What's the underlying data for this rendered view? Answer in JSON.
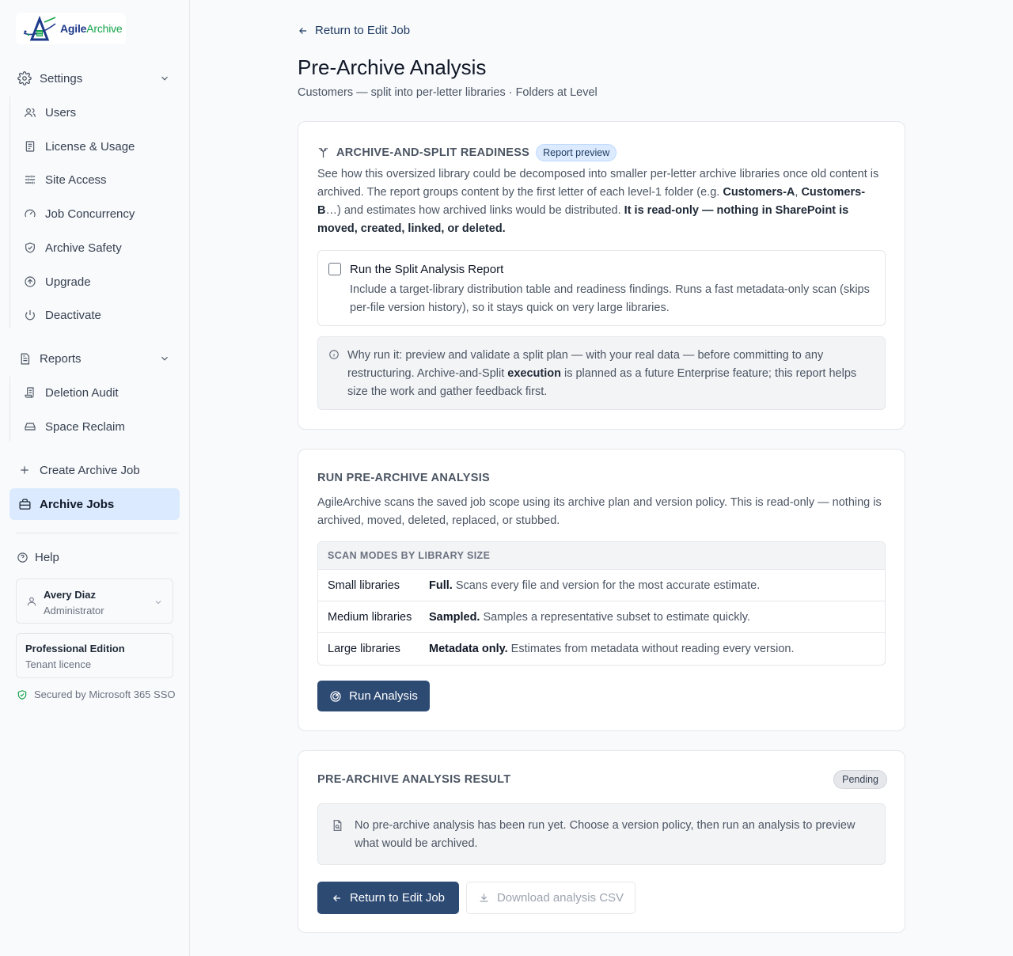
{
  "brand": {
    "logo_part1": "Agile",
    "logo_part2": "Archive"
  },
  "sidebar": {
    "settings": {
      "label": "Settings",
      "items": [
        {
          "label": "Users",
          "icon": "users-icon"
        },
        {
          "label": "License & Usage",
          "icon": "document-icon"
        },
        {
          "label": "Site Access",
          "icon": "sliders-icon"
        },
        {
          "label": "Job Concurrency",
          "icon": "gauge-icon"
        },
        {
          "label": "Archive Safety",
          "icon": "shield-check-icon"
        },
        {
          "label": "Upgrade",
          "icon": "upgrade-circle-icon"
        },
        {
          "label": "Deactivate",
          "icon": "power-icon"
        }
      ]
    },
    "reports": {
      "label": "Reports",
      "items": [
        {
          "label": "Deletion Audit",
          "icon": "scroll-icon"
        },
        {
          "label": "Space Reclaim",
          "icon": "hard-drive-icon"
        }
      ]
    },
    "create_job": "Create Archive Job",
    "archive_jobs": "Archive Jobs",
    "help": "Help",
    "user": {
      "name": "Avery Diaz",
      "role": "Administrator"
    },
    "edition": {
      "name": "Professional Edition",
      "type": "Tenant licence"
    },
    "secured": "Secured by Microsoft 365 SSO"
  },
  "main": {
    "back_link": "Return to Edit Job",
    "title": "Pre-Archive Analysis",
    "subtitle": "Customers — split into per-letter libraries · Folders at Level",
    "split_card": {
      "heading": "ARCHIVE-AND-SPLIT READINESS",
      "badge": "Report preview",
      "para_1": "See how this oversized library could be decomposed into smaller per-letter archive libraries once old content is archived. The report groups content by the first letter of each level-1 folder (e.g. ",
      "para_bold_1": "Customers-A",
      "para_2": ", ",
      "para_bold_2": "Customers-B",
      "para_3": "…) and estimates how archived links would be distributed. ",
      "para_bold_3": "It is read-only — nothing in SharePoint is moved, created, linked, or deleted.",
      "checkbox_title": "Run the Split Analysis Report",
      "checkbox_desc": "Include a target-library distribution table and readiness findings. Runs a fast metadata-only scan (skips per-file version history), so it stays quick on very large libraries.",
      "info_1": "Why run it: preview and validate a split plan — with your real data — before committing to any restructuring. Archive-and-Split ",
      "info_bold": "execution",
      "info_2": " is planned as a future Enterprise feature; this report helps size the work and gather feedback first."
    },
    "run_card": {
      "heading": "RUN PRE-ARCHIVE ANALYSIS",
      "para": "AgileArchive scans the saved job scope using its archive plan and version policy. This is read-only — nothing is archived, moved, deleted, replaced, or stubbed.",
      "table_header": "SCAN MODES BY LIBRARY SIZE",
      "rows": [
        {
          "size": "Small libraries",
          "mode": "Full.",
          "desc": " Scans every file and version for the most accurate estimate."
        },
        {
          "size": "Medium libraries",
          "mode": "Sampled.",
          "desc": " Samples a representative subset to estimate quickly."
        },
        {
          "size": "Large libraries",
          "mode": "Metadata only.",
          "desc": " Estimates from metadata without reading every version."
        }
      ],
      "run_button": "Run Analysis"
    },
    "result_card": {
      "heading": "PRE-ARCHIVE ANALYSIS RESULT",
      "status": "Pending",
      "empty_text": "No pre-archive analysis has been run yet. Choose a version policy, then run an analysis to preview what would be archived.",
      "return_button": "Return to Edit Job",
      "download_button": "Download analysis CSV"
    }
  },
  "colors": {
    "primary": "#2d4a73",
    "active_bg": "#dbeafe",
    "accent_green": "#16a34a"
  }
}
